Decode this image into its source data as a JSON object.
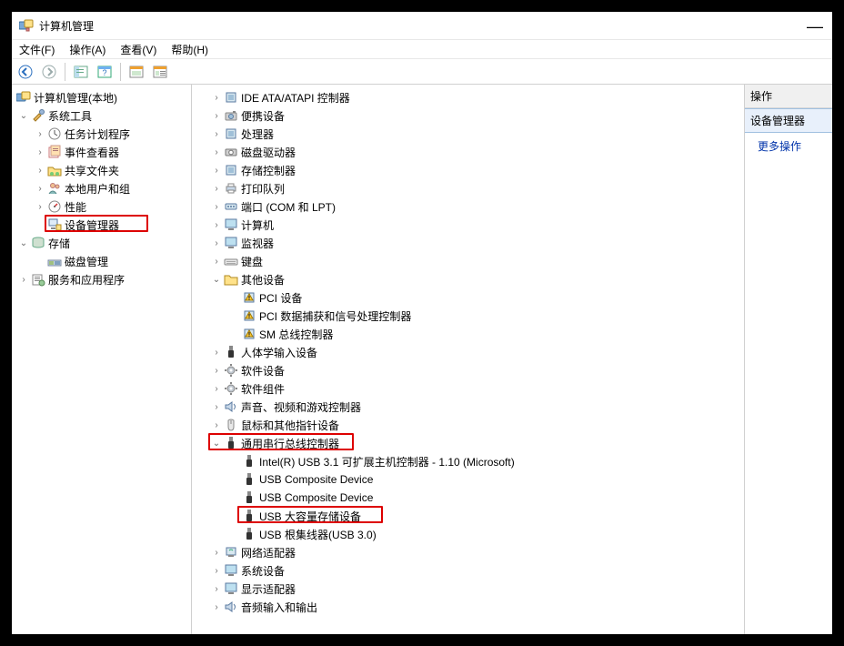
{
  "window": {
    "title": "计算机管理"
  },
  "menubar": {
    "file": "文件(F)",
    "action": "操作(A)",
    "view": "查看(V)",
    "help": "帮助(H)"
  },
  "left_tree": {
    "root": "计算机管理(本地)",
    "sys_tools": "系统工具",
    "task_sched": "任务计划程序",
    "event_viewer": "事件查看器",
    "shared_folders": "共享文件夹",
    "local_users": "本地用户和组",
    "performance": "性能",
    "device_manager": "设备管理器",
    "storage": "存储",
    "disk_mgmt": "磁盘管理",
    "services_apps": "服务和应用程序"
  },
  "mid_tree": {
    "ide": "IDE ATA/ATAPI 控制器",
    "portable": "便携设备",
    "cpu": "处理器",
    "diskdrive": "磁盘驱动器",
    "storage_ctrl": "存储控制器",
    "print_queue": "打印队列",
    "ports": "端口 (COM 和 LPT)",
    "computer": "计算机",
    "monitors": "监视器",
    "keyboard": "键盘",
    "other": "其他设备",
    "other_pci": "PCI 设备",
    "other_pcisig": "PCI 数据捕获和信号处理控制器",
    "other_sm": "SM 总线控制器",
    "hid": "人体学输入设备",
    "software_dev": "软件设备",
    "software_comp": "软件组件",
    "sound": "声音、视频和游戏控制器",
    "mouse": "鼠标和其他指针设备",
    "usb_ctrl": "通用串行总线控制器",
    "usb_intel": "Intel(R) USB 3.1 可扩展主机控制器 - 1.10 (Microsoft)",
    "usb_comp1": "USB Composite Device",
    "usb_comp2": "USB Composite Device",
    "usb_mass": "USB 大容量存储设备",
    "usb_roothub": "USB 根集线器(USB 3.0)",
    "network": "网络适配器",
    "system_dev": "系统设备",
    "display": "显示适配器",
    "audio_io": "音频输入和输出"
  },
  "right": {
    "header": "操作",
    "selected": "设备管理器",
    "more": "更多操作"
  }
}
